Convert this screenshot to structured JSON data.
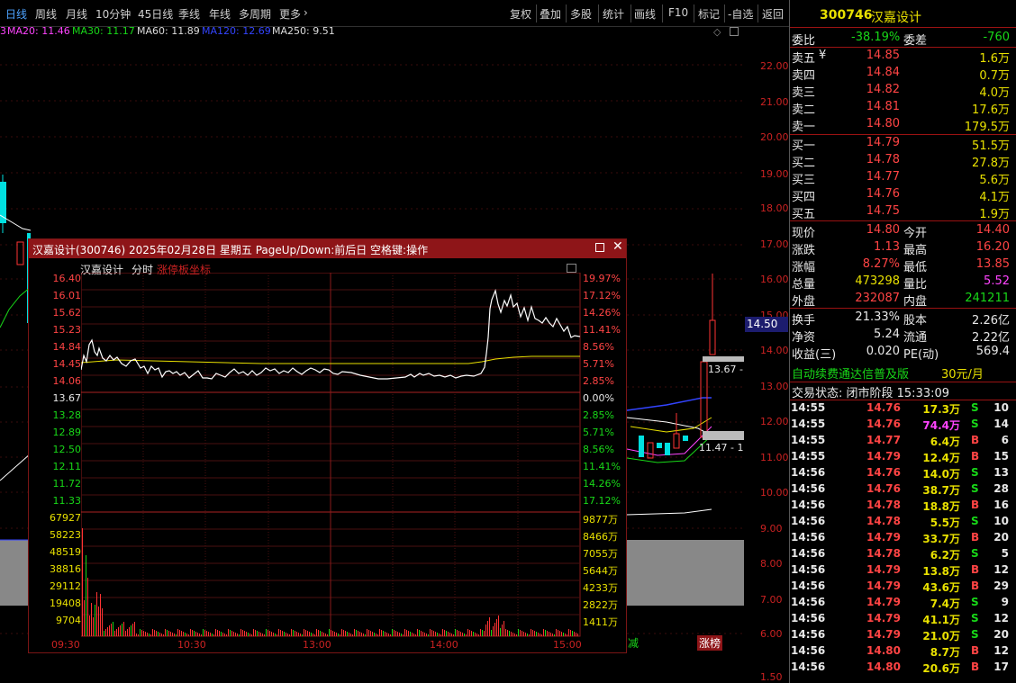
{
  "toolbar": {
    "periods": [
      "日线",
      "周线",
      "月线",
      "10分钟",
      "45日线",
      "季线",
      "年线",
      "多周期",
      "更多"
    ],
    "more_arrow": "›",
    "right_tools": [
      "复权",
      "叠加",
      "多股",
      "统计",
      "画线",
      "F10",
      "标记",
      "-自选",
      "返回"
    ]
  },
  "ma_line": {
    "items": [
      {
        "label": "MA20: 11.46",
        "color": "#ff44ff"
      },
      {
        "label": "MA30: 11.17",
        "color": "#18d818"
      },
      {
        "label": "MA60: 11.89",
        "color": "#dddddd"
      },
      {
        "label": "MA120: 12.69",
        "color": "#3344ff"
      },
      {
        "label": "MA250: 9.51",
        "color": "#dddddd"
      }
    ],
    "head_fragment": "3"
  },
  "main_axis": {
    "labels": [
      "22.00",
      "21.00",
      "20.00",
      "19.00",
      "18.00",
      "17.00",
      "16.00",
      "15.00",
      "14.00",
      "13.00",
      "12.00",
      "11.00",
      "10.00",
      "9.00",
      "8.00",
      "7.00",
      "6.00",
      "1.50"
    ],
    "current_price_tag": "14.50",
    "annot_high": "13.67 -",
    "annot_low": "11.47 - 1",
    "bottom_tag_left": "减",
    "bottom_tag_right": "涨榜"
  },
  "quote": {
    "code": "300746",
    "name": "汉嘉设计",
    "weibi_label": "委比",
    "weibi": "-38.19%",
    "weicha_label": "委差",
    "weicha": "-760",
    "sells": [
      {
        "label": "卖五",
        "mark": "¥",
        "price": "14.85",
        "vol": "1.6万"
      },
      {
        "label": "卖四",
        "mark": "",
        "price": "14.84",
        "vol": "0.7万"
      },
      {
        "label": "卖三",
        "mark": "",
        "price": "14.82",
        "vol": "4.0万"
      },
      {
        "label": "卖二",
        "mark": "",
        "price": "14.81",
        "vol": "17.6万"
      },
      {
        "label": "卖一",
        "mark": "",
        "price": "14.80",
        "vol": "179.5万"
      }
    ],
    "buys": [
      {
        "label": "买一",
        "price": "14.79",
        "vol": "51.5万"
      },
      {
        "label": "买二",
        "price": "14.78",
        "vol": "27.8万"
      },
      {
        "label": "买三",
        "price": "14.77",
        "vol": "5.6万"
      },
      {
        "label": "买四",
        "price": "14.76",
        "vol": "4.1万"
      },
      {
        "label": "买五",
        "price": "14.75",
        "vol": "1.9万"
      }
    ],
    "stats": [
      {
        "l1": "现价",
        "v1": "14.80",
        "c1": "red",
        "l2": "今开",
        "v2": "14.40",
        "c2": "red"
      },
      {
        "l1": "涨跌",
        "v1": "1.13",
        "c1": "red",
        "l2": "最高",
        "v2": "16.20",
        "c2": "red"
      },
      {
        "l1": "涨幅",
        "v1": "8.27%",
        "c1": "red",
        "l2": "最低",
        "v2": "13.85",
        "c2": "red"
      },
      {
        "l1": "总量",
        "v1": "473298",
        "c1": "yellow",
        "l2": "量比",
        "v2": "5.52",
        "c2": "magenta"
      },
      {
        "l1": "外盘",
        "v1": "232087",
        "c1": "red",
        "l2": "内盘",
        "v2": "241211",
        "c2": "green"
      }
    ],
    "fund": [
      {
        "l1": "换手",
        "v1": "21.33%",
        "l2": "股本",
        "v2": "2.26亿"
      },
      {
        "l1": "净资",
        "v1": "5.24",
        "l2": "流通",
        "v2": "2.22亿"
      },
      {
        "l1": "收益(三)",
        "v1": "0.020",
        "l2": "PE(动)",
        "v2": "569.4"
      }
    ],
    "ad_text": "自动续费通达信普及版",
    "ad_price": "30元/月",
    "trade_status": "交易状态: 闭市阶段 15:33:09"
  },
  "ticks": [
    {
      "time": "14:55",
      "price": "14.76",
      "vol": "17.3万",
      "side": "S",
      "n": "10"
    },
    {
      "time": "14:55",
      "price": "14.76",
      "vol": "74.4万",
      "side": "S",
      "n": "14"
    },
    {
      "time": "14:55",
      "price": "14.77",
      "vol": "6.4万",
      "side": "B",
      "n": "6"
    },
    {
      "time": "14:55",
      "price": "14.79",
      "vol": "12.4万",
      "side": "B",
      "n": "15"
    },
    {
      "time": "14:56",
      "price": "14.76",
      "vol": "14.0万",
      "side": "S",
      "n": "13"
    },
    {
      "time": "14:56",
      "price": "14.76",
      "vol": "38.7万",
      "side": "S",
      "n": "28"
    },
    {
      "time": "14:56",
      "price": "14.78",
      "vol": "18.8万",
      "side": "B",
      "n": "16"
    },
    {
      "time": "14:56",
      "price": "14.78",
      "vol": "5.5万",
      "side": "S",
      "n": "10"
    },
    {
      "time": "14:56",
      "price": "14.79",
      "vol": "33.7万",
      "side": "B",
      "n": "20"
    },
    {
      "time": "14:56",
      "price": "14.78",
      "vol": "6.2万",
      "side": "S",
      "n": "5"
    },
    {
      "time": "14:56",
      "price": "14.79",
      "vol": "13.8万",
      "side": "B",
      "n": "12"
    },
    {
      "time": "14:56",
      "price": "14.79",
      "vol": "43.6万",
      "side": "B",
      "n": "29"
    },
    {
      "time": "14:56",
      "price": "14.79",
      "vol": "7.4万",
      "side": "S",
      "n": "9"
    },
    {
      "time": "14:56",
      "price": "14.79",
      "vol": "41.1万",
      "side": "S",
      "n": "12"
    },
    {
      "time": "14:56",
      "price": "14.79",
      "vol": "21.0万",
      "side": "S",
      "n": "20"
    },
    {
      "time": "14:56",
      "price": "14.80",
      "vol": "8.7万",
      "side": "B",
      "n": "12"
    },
    {
      "time": "14:56",
      "price": "14.80",
      "vol": "20.6万",
      "side": "B",
      "n": "17"
    }
  ],
  "popup": {
    "title": "汉嘉设计(300746) 2025年02月28日 星期五 PageUp/Down:前后日 空格键:操作",
    "tab_name": "汉嘉设计",
    "tab_fenshi": "分时",
    "tab_limit": "涨停板坐标",
    "price_left": [
      "16.40",
      "16.01",
      "15.62",
      "15.23",
      "14.84",
      "14.45",
      "14.06",
      "13.67",
      "13.28",
      "12.89",
      "12.50",
      "12.11",
      "11.72",
      "11.33"
    ],
    "pct_right": [
      "19.97%",
      "17.12%",
      "14.26%",
      "11.41%",
      "8.56%",
      "5.71%",
      "2.85%",
      "0.00%",
      "2.85%",
      "5.71%",
      "8.56%",
      "11.41%",
      "14.26%",
      "17.12%"
    ],
    "vol_left": [
      "67927",
      "58223",
      "48519",
      "38816",
      "29112",
      "19408",
      "9704"
    ],
    "vol_right": [
      "9877万",
      "8466万",
      "7055万",
      "5644万",
      "4233万",
      "2822万",
      "1411万"
    ],
    "times": [
      "09:30",
      "10:30",
      "13:00",
      "14:00",
      "15:00"
    ]
  },
  "colors": {
    "up": "#ff4444",
    "down": "#18d818",
    "avg": "#e8e000",
    "price": "#ffffff",
    "title_bar": "#8e1518"
  }
}
